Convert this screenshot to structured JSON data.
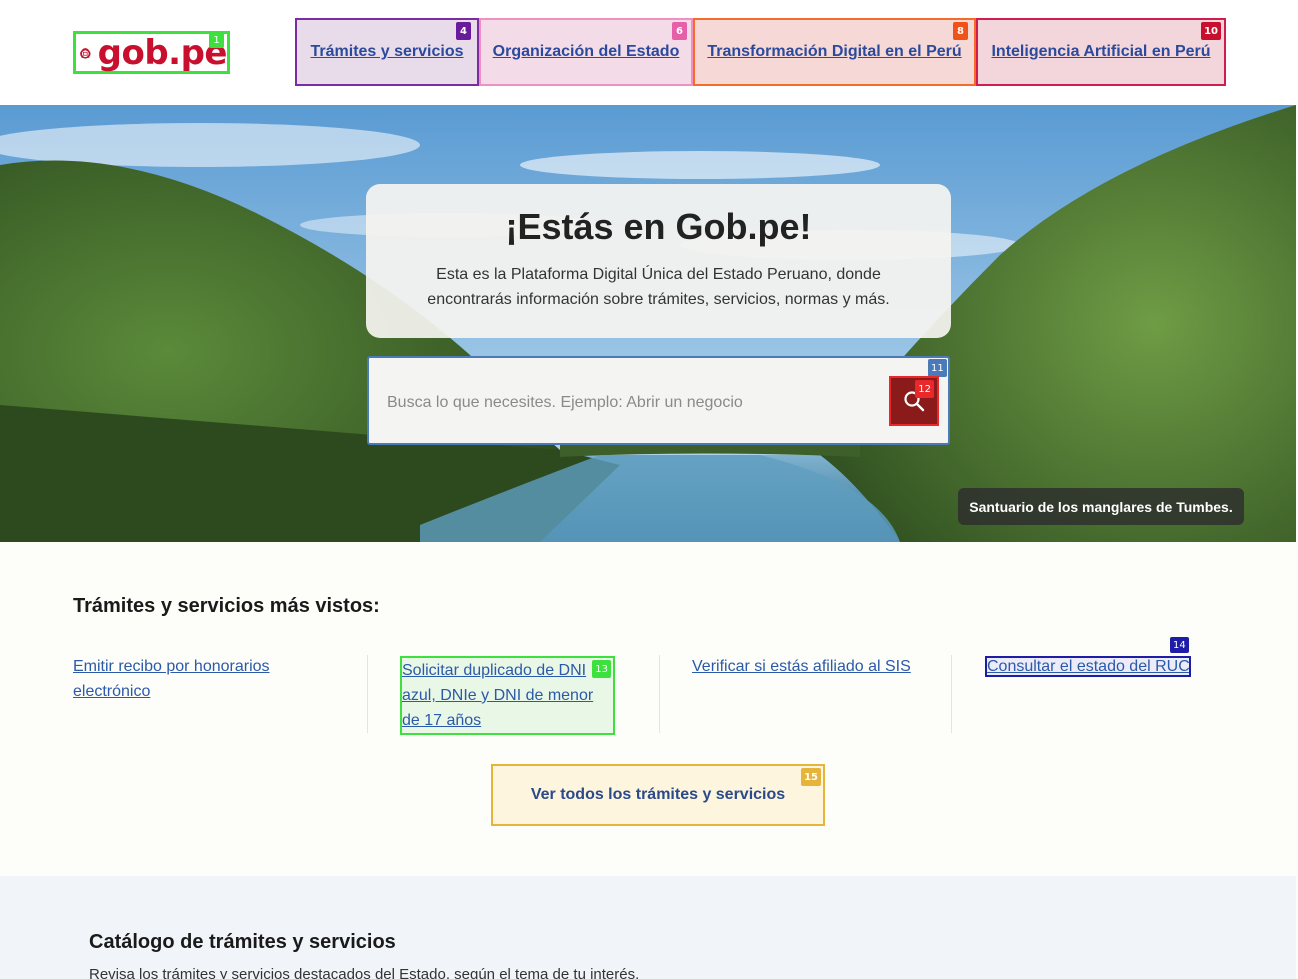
{
  "header": {
    "logo_text": "gob.pe",
    "logo_badge": "1",
    "nav": [
      {
        "label": "Trámites y servicios",
        "badge": "4",
        "badge_color": "#6a1b9a",
        "border_color": "#7b2ca0",
        "bg": "#e9dcea"
      },
      {
        "label": "Organización del Estado",
        "badge": "6",
        "badge_color": "#e75fa8",
        "border_color": "#ef8fc4",
        "bg": "#f3dbe8"
      },
      {
        "label": "Transformación Digital en el Perú",
        "badge": "8",
        "badge_color": "#f0531a",
        "border_color": "#f46b2a",
        "bg": "#f6d9d6"
      },
      {
        "label": "Inteligencia Artificial en Perú",
        "badge": "10",
        "badge_color": "#c8102e",
        "border_color": "#d01d4d",
        "bg": "#f3d6dc"
      }
    ]
  },
  "hero": {
    "title": "¡Estás en Gob.pe!",
    "description": "Esta es la Plataforma Digital Única del Estado Peruano, donde encontrarás información sobre trámites, servicios, normas y más.",
    "search_placeholder": "Busca lo que necesites. Ejemplo: Abrir un negocio",
    "search_badge": "11",
    "search_button_badge": "12",
    "caption": "Santuario de los manglares de Tumbes."
  },
  "top_services": {
    "title": "Trámites y servicios más vistos:",
    "items": [
      {
        "label": "Emitir recibo por honorarios electrónico"
      },
      {
        "label": "Solicitar duplicado de DNI azul, DNIe y DNI de menor de 17 años",
        "badge": "13"
      },
      {
        "label": "Verificar si estás afiliado al SIS"
      },
      {
        "label": "Consultar el estado del RUC",
        "badge": "14"
      }
    ],
    "view_all_label": "Ver todos los trámites y servicios",
    "view_all_badge": "15"
  },
  "catalog": {
    "title": "Catálogo de trámites y servicios",
    "description": "Revisa los trámites y servicios destacados del Estado, según el tema de tu interés."
  }
}
